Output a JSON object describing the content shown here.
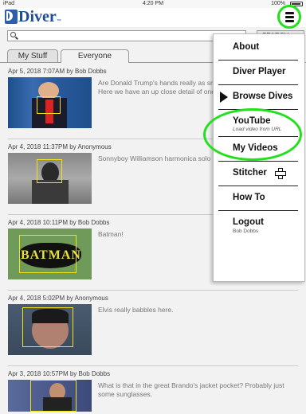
{
  "status_bar": {
    "device": "iPad",
    "time": "4:20 PM",
    "battery": "100%"
  },
  "app": {
    "logo_text": "Diver",
    "trademark": "™"
  },
  "search": {
    "placeholder": "",
    "button_label": "SEARCH"
  },
  "tabs": [
    {
      "label": "My Stuff",
      "active": false
    },
    {
      "label": "Everyone",
      "active": true
    }
  ],
  "feed": [
    {
      "meta": "Apr 5, 2018 7:07AM by Bob Dobbs",
      "description": "Are Donald Trump's hands really as small as they say?! Maybe? Here we have an up close detail of one of the alleged \"tiny hands.\""
    },
    {
      "meta": "Apr 4, 2018 11:37PM by Anonymous",
      "description": "Sonnyboy Williamson harmonica solo"
    },
    {
      "meta": "Apr 4, 2018 10:11PM by Bob Dobbs",
      "description": "Batman!",
      "thumb_text": "BATMAN"
    },
    {
      "meta": "Apr 4, 2018 5:02PM by Anonymous",
      "description": "Elvis really babbles here."
    },
    {
      "meta": "Apr 3, 2018 10:57PM by Bob Dobbs",
      "description": "What is that in the great Brando's jacket pocket? Probably just some sunglasses."
    }
  ],
  "menu": {
    "items": [
      {
        "label": "About"
      },
      {
        "label": "Diver Player"
      },
      {
        "label": "Browse Dives",
        "current": true
      },
      {
        "label": "YouTube",
        "sub": "Load video from URL"
      },
      {
        "label": "My Videos"
      },
      {
        "label": "Stitcher"
      },
      {
        "label": "How To"
      },
      {
        "label": "Logout",
        "sub": "Bob Dobbs"
      }
    ]
  },
  "colors": {
    "highlight_green": "#22e01c",
    "selection_yellow": "#f0e414",
    "brand_blue": "#1d4d94"
  }
}
